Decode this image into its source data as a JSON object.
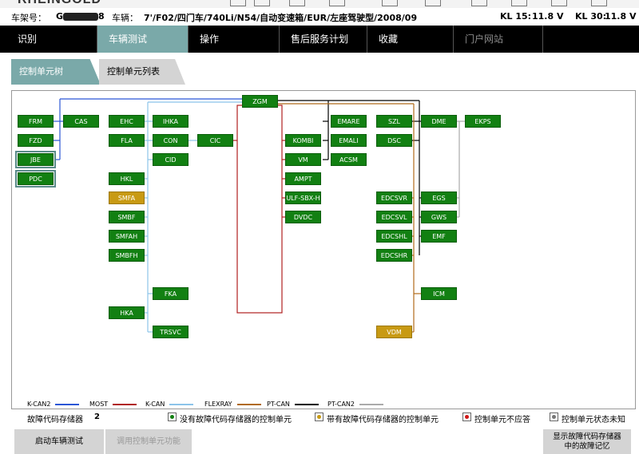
{
  "header": {
    "app_title_partial": "RHEINGOLD",
    "chassis_label": "车架号：",
    "chassis_value_visible": "G",
    "chassis_value_end": "8",
    "vehicle_label": "车辆：",
    "vehicle_value": "7'/F02/四门车/740Li/N54/自动变速箱/EUR/左座驾驶型/2008/09",
    "kl15_label": "KL 15:",
    "kl15_value": "11.8 V",
    "kl30_label": "KL 30:",
    "kl30_value": "11.8 V"
  },
  "menu": {
    "items": [
      {
        "label": "识别"
      },
      {
        "label": "车辆测试"
      },
      {
        "label": "操作"
      },
      {
        "label": "售后服务计划"
      },
      {
        "label": "收藏"
      },
      {
        "label": "门户网站"
      }
    ],
    "active_index": 1
  },
  "subtabs": {
    "tree": "控制单元树",
    "list": "控制单元列表"
  },
  "ecus": {
    "FRM": "FRM",
    "CAS": "CAS",
    "FZD": "FZD",
    "JBE": "JBE",
    "PDC": "PDC",
    "EHC": "EHC",
    "IHKA": "IHKA",
    "FLA": "FLA",
    "CON": "CON",
    "CIC": "CIC",
    "CID": "CID",
    "HKL": "HKL",
    "SMFA": "SMFA",
    "SMBF": "SMBF",
    "SMFAH": "SMFAH",
    "SMBFH": "SMBFH",
    "FKA": "FKA",
    "HKA": "HKA",
    "TRSVC": "TRSVC",
    "ZGM": "ZGM",
    "KOMBI": "KOMBI",
    "VM": "VM",
    "AMPT": "AMPT",
    "ULF": "ULF-SBX-H",
    "DVDC": "DVDC",
    "EMARE": "EMARE",
    "EMALI": "EMALI",
    "ACSM": "ACSM",
    "SZL": "SZL",
    "DSC": "DSC",
    "DME": "DME",
    "EKPS": "EKPS",
    "EDCSVR": "EDCSVR",
    "EGS": "EGS",
    "EDCSVL": "EDCSVL",
    "GWS": "GWS",
    "EDCSHL": "EDCSHL",
    "EMF": "EMF",
    "EDCSHR": "EDCSHR",
    "ICM": "ICM",
    "VDM": "VDM"
  },
  "ecu_status": {
    "ok_color": "#128012",
    "fault_color": "#c89a13",
    "faulty": [
      "SMFA",
      "VDM"
    ]
  },
  "legend": {
    "kcan2": "K-CAN2",
    "most": "MOST",
    "kcan": "K-CAN",
    "flexray": "FLEXRAY",
    "ptcan": "PT-CAN",
    "ptcan2": "PT-CAN2",
    "colors": {
      "kcan2": "#2b56d6",
      "most": "#b02020",
      "kcan": "#8cc4ea",
      "flexray": "#b06a1a",
      "ptcan": "#000000",
      "ptcan2": "#aaaaaa"
    }
  },
  "status": {
    "fault_memory_label": "故障代码存储器",
    "fault_memory_count": "2",
    "legend_ok": "没有故障代码存储器的控制单元",
    "legend_fault": "带有故障代码存储器的控制单元",
    "legend_noresp": "控制单元不应答",
    "legend_unknown": "控制单元状态未知"
  },
  "buttons": {
    "start_test": "启动车辆测试",
    "call_function": "调用控制单元功能",
    "show_fault_line1": "显示故障代码存储器",
    "show_fault_line2": "中的故障记忆"
  }
}
